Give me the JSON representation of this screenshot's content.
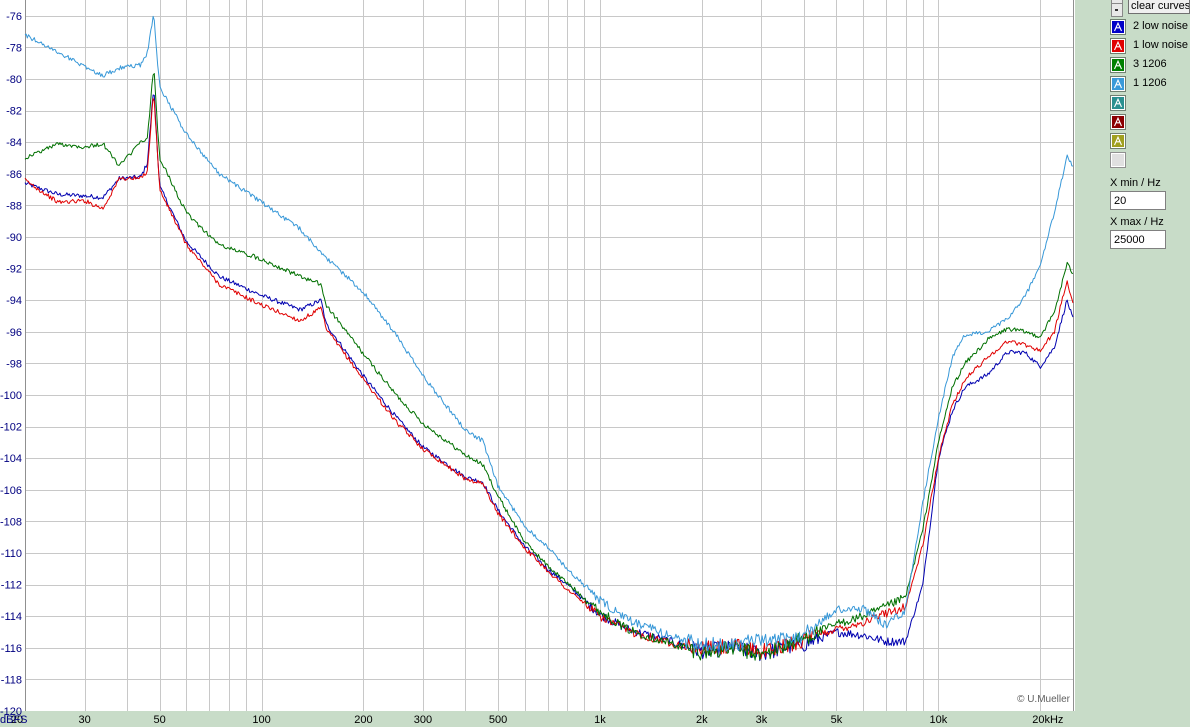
{
  "chart_data": {
    "type": "line",
    "x_scale": "log",
    "xlim": [
      20,
      25000
    ],
    "ylim": [
      -120,
      -75
    ],
    "grid": true,
    "ylabel": "dBFS",
    "x_tick_labels": [
      {
        "value": 20,
        "label": "20"
      },
      {
        "value": 30,
        "label": "30"
      },
      {
        "value": 50,
        "label": "50"
      },
      {
        "value": 100,
        "label": "100"
      },
      {
        "value": 200,
        "label": "200"
      },
      {
        "value": 300,
        "label": "300"
      },
      {
        "value": 500,
        "label": "500"
      },
      {
        "value": 1000,
        "label": "1k"
      },
      {
        "value": 2000,
        "label": "2k"
      },
      {
        "value": 3000,
        "label": "3k"
      },
      {
        "value": 5000,
        "label": "5k"
      },
      {
        "value": 10000,
        "label": "10k"
      },
      {
        "value": 20000,
        "label": "20kHz"
      }
    ],
    "y_tick_labels": [
      "-76",
      "-78",
      "-80",
      "-82",
      "-84",
      "-86",
      "-88",
      "-90",
      "-92",
      "-94",
      "-96",
      "-98",
      "-100",
      "-102",
      "-104",
      "-106",
      "-108",
      "-110",
      "-112",
      "-114",
      "-116",
      "-118",
      "-120"
    ],
    "watermark": "© U.Mueller",
    "series": [
      {
        "name": "2 low noise",
        "color": "#0000b0",
        "points": [
          [
            20,
            -86.6
          ],
          [
            25,
            -87.3
          ],
          [
            30,
            -87.4
          ],
          [
            34,
            -87.5
          ],
          [
            38,
            -86.3
          ],
          [
            44,
            -86.2
          ],
          [
            46,
            -85.3
          ],
          [
            48,
            -80.5
          ],
          [
            50,
            -86.8
          ],
          [
            60,
            -90.3
          ],
          [
            75,
            -92.5
          ],
          [
            100,
            -93.7
          ],
          [
            130,
            -94.6
          ],
          [
            150,
            -94.0
          ],
          [
            155,
            -95.5
          ],
          [
            200,
            -98.8
          ],
          [
            250,
            -101.4
          ],
          [
            300,
            -103.3
          ],
          [
            400,
            -105.2
          ],
          [
            450,
            -105.5
          ],
          [
            500,
            -107.3
          ],
          [
            600,
            -109.6
          ],
          [
            700,
            -111.0
          ],
          [
            800,
            -112.0
          ],
          [
            1000,
            -113.9
          ],
          [
            1200,
            -114.8
          ],
          [
            1500,
            -115.4
          ],
          [
            2000,
            -116.2
          ],
          [
            2500,
            -116.0
          ],
          [
            3000,
            -116.4
          ],
          [
            3500,
            -116.0
          ],
          [
            4000,
            -115.8
          ],
          [
            5000,
            -115.0
          ],
          [
            6000,
            -115.2
          ],
          [
            7000,
            -115.6
          ],
          [
            8000,
            -115.6
          ],
          [
            9000,
            -112.0
          ],
          [
            10000,
            -104.0
          ],
          [
            11000,
            -101.0
          ],
          [
            12000,
            -99.5
          ],
          [
            14000,
            -98.7
          ],
          [
            16000,
            -97.3
          ],
          [
            18000,
            -97.3
          ],
          [
            20000,
            -98.2
          ],
          [
            22000,
            -97.0
          ],
          [
            24000,
            -94.0
          ],
          [
            25000,
            -95.2
          ]
        ]
      },
      {
        "name": "1 low noise",
        "color": "#e00000",
        "points": [
          [
            20,
            -86.4
          ],
          [
            25,
            -87.8
          ],
          [
            30,
            -87.7
          ],
          [
            34,
            -88.2
          ],
          [
            38,
            -86.3
          ],
          [
            44,
            -86.3
          ],
          [
            46,
            -85.8
          ],
          [
            48,
            -80.7
          ],
          [
            50,
            -87.0
          ],
          [
            60,
            -90.5
          ],
          [
            75,
            -93.0
          ],
          [
            100,
            -94.3
          ],
          [
            130,
            -95.3
          ],
          [
            150,
            -94.5
          ],
          [
            155,
            -95.8
          ],
          [
            200,
            -99.0
          ],
          [
            250,
            -101.7
          ],
          [
            300,
            -103.4
          ],
          [
            400,
            -105.3
          ],
          [
            450,
            -105.6
          ],
          [
            500,
            -107.5
          ],
          [
            600,
            -109.7
          ],
          [
            700,
            -111.1
          ],
          [
            800,
            -112.3
          ],
          [
            1000,
            -114.0
          ],
          [
            1200,
            -114.9
          ],
          [
            1500,
            -115.5
          ],
          [
            2000,
            -116.1
          ],
          [
            2500,
            -115.9
          ],
          [
            3000,
            -116.2
          ],
          [
            3500,
            -115.9
          ],
          [
            4000,
            -115.5
          ],
          [
            5000,
            -114.8
          ],
          [
            6000,
            -114.4
          ],
          [
            7000,
            -113.8
          ],
          [
            8000,
            -113.4
          ],
          [
            9000,
            -109.5
          ],
          [
            10000,
            -104.0
          ],
          [
            11000,
            -100.6
          ],
          [
            12000,
            -99.0
          ],
          [
            14000,
            -97.6
          ],
          [
            16000,
            -96.6
          ],
          [
            18000,
            -96.8
          ],
          [
            20000,
            -97.2
          ],
          [
            22000,
            -96.0
          ],
          [
            24000,
            -92.8
          ],
          [
            25000,
            -94.2
          ]
        ]
      },
      {
        "name": "3 1206",
        "color": "#007000",
        "points": [
          [
            20,
            -85.0
          ],
          [
            25,
            -84.1
          ],
          [
            30,
            -84.3
          ],
          [
            34,
            -84.1
          ],
          [
            38,
            -85.5
          ],
          [
            44,
            -84.0
          ],
          [
            46,
            -83.8
          ],
          [
            48,
            -79.2
          ],
          [
            50,
            -85.0
          ],
          [
            60,
            -88.5
          ],
          [
            75,
            -90.5
          ],
          [
            100,
            -91.4
          ],
          [
            130,
            -92.5
          ],
          [
            150,
            -93.0
          ],
          [
            155,
            -94.3
          ],
          [
            200,
            -97.4
          ],
          [
            250,
            -100.0
          ],
          [
            300,
            -101.8
          ],
          [
            400,
            -103.8
          ],
          [
            450,
            -104.4
          ],
          [
            500,
            -106.4
          ],
          [
            600,
            -109.3
          ],
          [
            700,
            -110.8
          ],
          [
            800,
            -111.9
          ],
          [
            1000,
            -113.7
          ],
          [
            1200,
            -114.8
          ],
          [
            1500,
            -115.5
          ],
          [
            2000,
            -116.3
          ],
          [
            2500,
            -116.0
          ],
          [
            3000,
            -116.5
          ],
          [
            3500,
            -115.9
          ],
          [
            4000,
            -115.4
          ],
          [
            5000,
            -114.5
          ],
          [
            6000,
            -114.0
          ],
          [
            7000,
            -113.4
          ],
          [
            8000,
            -112.8
          ],
          [
            9000,
            -108.5
          ],
          [
            10000,
            -103.0
          ],
          [
            11000,
            -99.5
          ],
          [
            12000,
            -98.0
          ],
          [
            14000,
            -96.5
          ],
          [
            16000,
            -95.8
          ],
          [
            18000,
            -96.0
          ],
          [
            20000,
            -96.3
          ],
          [
            22000,
            -94.8
          ],
          [
            24000,
            -91.7
          ],
          [
            25000,
            -92.3
          ]
        ]
      },
      {
        "name": "1 1206",
        "color": "#3898d8",
        "points": [
          [
            20,
            -77.2
          ],
          [
            25,
            -78.3
          ],
          [
            30,
            -79.2
          ],
          [
            34,
            -79.8
          ],
          [
            38,
            -79.3
          ],
          [
            44,
            -79.1
          ],
          [
            46,
            -78.3
          ],
          [
            48,
            -75.9
          ],
          [
            50,
            -80.5
          ],
          [
            60,
            -83.5
          ],
          [
            75,
            -86.0
          ],
          [
            100,
            -87.8
          ],
          [
            130,
            -89.5
          ],
          [
            150,
            -91.0
          ],
          [
            200,
            -93.5
          ],
          [
            250,
            -96.2
          ],
          [
            300,
            -98.8
          ],
          [
            400,
            -102.2
          ],
          [
            450,
            -102.9
          ],
          [
            500,
            -105.8
          ],
          [
            600,
            -108.3
          ],
          [
            700,
            -109.6
          ],
          [
            800,
            -111.0
          ],
          [
            1000,
            -113.0
          ],
          [
            1200,
            -114.2
          ],
          [
            1500,
            -115.0
          ],
          [
            2000,
            -115.9
          ],
          [
            2500,
            -115.7
          ],
          [
            3000,
            -115.6
          ],
          [
            3500,
            -115.5
          ],
          [
            4000,
            -115.2
          ],
          [
            5000,
            -113.6
          ],
          [
            6000,
            -113.5
          ],
          [
            7000,
            -114.6
          ],
          [
            8000,
            -113.6
          ],
          [
            9000,
            -106.8
          ],
          [
            10000,
            -101.5
          ],
          [
            11000,
            -97.6
          ],
          [
            12000,
            -96.2
          ],
          [
            14000,
            -96.0
          ],
          [
            16000,
            -95.2
          ],
          [
            18000,
            -93.8
          ],
          [
            20000,
            -91.8
          ],
          [
            22000,
            -88.5
          ],
          [
            24000,
            -84.9
          ],
          [
            25000,
            -85.6
          ]
        ]
      }
    ]
  },
  "panel": {
    "clear_curves_label": "clear curves",
    "legend": [
      {
        "label": "2 low noise",
        "color": "#0000c8",
        "icon": "curve-a-icon"
      },
      {
        "label": "1 low noise",
        "color": "#e00000",
        "icon": "curve-a-icon"
      },
      {
        "label": "3 1206",
        "color": "#008000",
        "icon": "curve-a-icon"
      },
      {
        "label": "1 1206",
        "color": "#3a9ad9",
        "icon": "curve-a-icon"
      },
      {
        "label": "",
        "color": "#2a9090",
        "icon": "curve-a-icon"
      },
      {
        "label": "",
        "color": "#8b0000",
        "icon": "curve-a-icon"
      },
      {
        "label": "",
        "color": "#a0a020",
        "icon": "curve-a-icon"
      },
      {
        "label": "",
        "color": "#e0e0e0",
        "icon": "empty-slot-icon"
      }
    ],
    "xmin_label": "X min / Hz",
    "xmin_value": "20",
    "xmax_label": "X max / Hz",
    "xmax_value": "25000"
  }
}
